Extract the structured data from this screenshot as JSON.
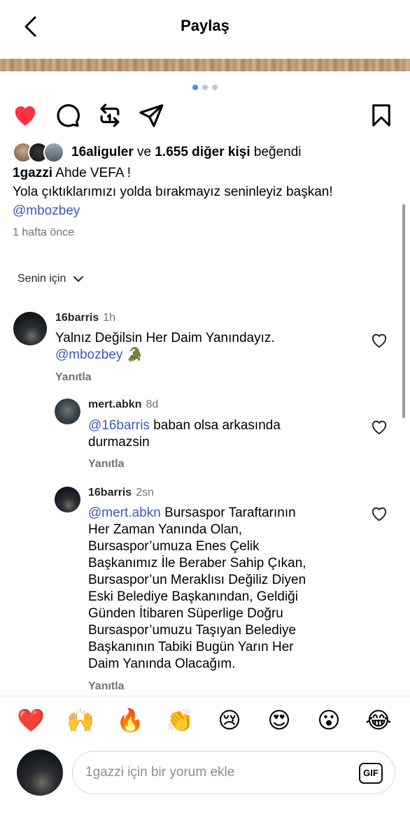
{
  "header": {
    "title": "Paylaş"
  },
  "carousel": {
    "count": 3,
    "active": 0
  },
  "colors": {
    "like_red": "#ff3040",
    "mention_blue": "#3b5ab8",
    "carousel_active": "#3897f0"
  },
  "likes": {
    "first_user": "16aliguler",
    "connector": "ve",
    "others": "1.655 diğer kişi",
    "suffix": "beğendi"
  },
  "caption": {
    "username": "1gazzi",
    "line1": "Ahde VEFA !",
    "line2": "Yola çıktıklarımızı yolda bırakmayız seninleyiz başkan!",
    "mention": "@mbozbey"
  },
  "time_ago": "1 hafta önce",
  "sort": {
    "label": "Senin için"
  },
  "comments": [
    {
      "username": "16barris",
      "time": "1h",
      "text_plain": "Yalnız Değilsin Her Daim Yanındayız.",
      "mention": "@mbozbey",
      "emoji": "🐊",
      "reply_label": "Yanıtla"
    },
    {
      "username": "mert.abkn",
      "time": "8d",
      "mention": "@16barris",
      "text": "baban olsa arkasında",
      "text_line2": "durmazsin",
      "reply_label": "Yanıtla"
    },
    {
      "username": "16barris",
      "time": "2sn",
      "mention": "@mert.abkn",
      "line1": "Bursaspor Taraftarının",
      "line2": "Her Zaman Yanında Olan,",
      "line3": "Bursaspor’umuza Enes Çelik",
      "line4": "Başkanımız İle Beraber Sahip Çıkan,",
      "line5": "Bursaspor’un Meraklısı Değiliz Diyen",
      "line6": "Eski Belediye Başkanından, Geldiği",
      "line7": "Günden İtibaren Süperlige Doğru",
      "line8": "Bursaspor’umuzu Taşıyan Belediye",
      "line9": "Başkanının Tabiki Bugün Yarın Her",
      "line10": "Daim Yanında Olacağım.",
      "reply_label": "Yanıtla"
    }
  ],
  "quick_reactions": [
    "❤️",
    "🙌",
    "🔥",
    "👏",
    "😢",
    "😍",
    "😮",
    "😂"
  ],
  "comment_input": {
    "placeholder": "1gazzi için bir yorum ekle",
    "gif_label": "GIF"
  }
}
